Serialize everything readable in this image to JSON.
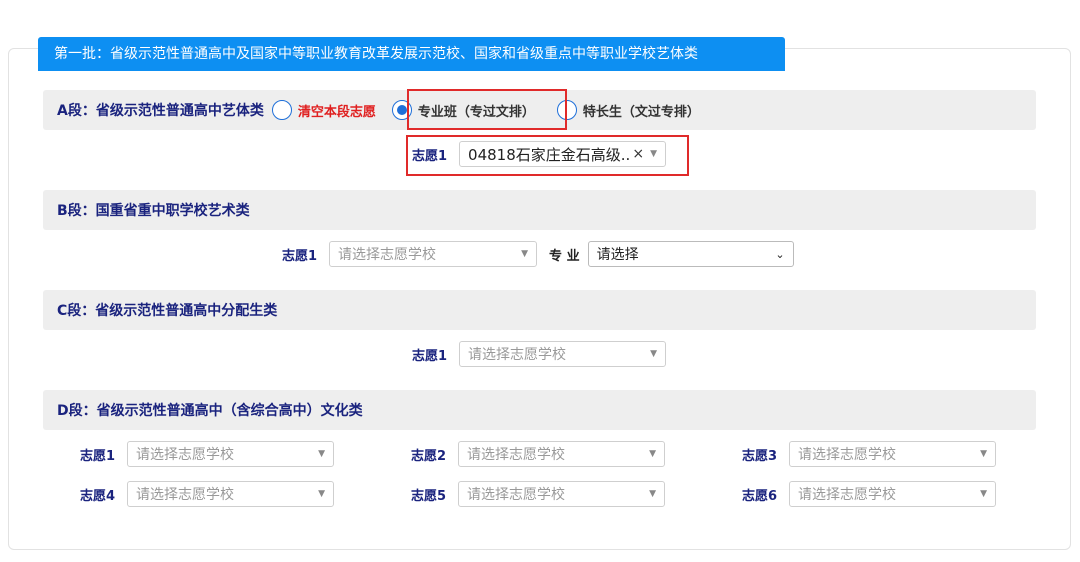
{
  "batch_title": "第一批：省级示范性普通高中及国家中等职业教育改革发展示范校、国家和省级重点中等职业学校艺体类",
  "segment_a": {
    "title": "A段：省级示范性普通高中艺体类",
    "clear_label": "清空本段志愿",
    "option_professional": "专业班（专过文排）",
    "option_specialty": "特长生（文过专排）",
    "choice1_label": "志愿1",
    "choice1_value": "04818石家庄金石高级..."
  },
  "segment_b": {
    "title": "B段：国重省重中职学校艺术类",
    "choice1_label": "志愿1",
    "choice1_placeholder": "请选择志愿学校",
    "major_label": "专 业",
    "major_value": "请选择"
  },
  "segment_c": {
    "title": "C段：省级示范性普通高中分配生类",
    "choice1_label": "志愿1",
    "choice1_placeholder": "请选择志愿学校"
  },
  "segment_d": {
    "title": "D段：省级示范性普通高中（含综合高中）文化类",
    "choices": [
      {
        "label": "志愿1",
        "placeholder": "请选择志愿学校"
      },
      {
        "label": "志愿2",
        "placeholder": "请选择志愿学校"
      },
      {
        "label": "志愿3",
        "placeholder": "请选择志愿学校"
      },
      {
        "label": "志愿4",
        "placeholder": "请选择志愿学校"
      },
      {
        "label": "志愿5",
        "placeholder": "请选择志愿学校"
      },
      {
        "label": "志愿6",
        "placeholder": "请选择志愿学校"
      }
    ]
  },
  "icons": {
    "dropdown": "chevron-down-icon",
    "clear": "close-icon"
  },
  "colors": {
    "accent": "#0d8ff2",
    "label": "#1a237e",
    "danger": "#e02020",
    "highlight": "#e02a2a"
  }
}
